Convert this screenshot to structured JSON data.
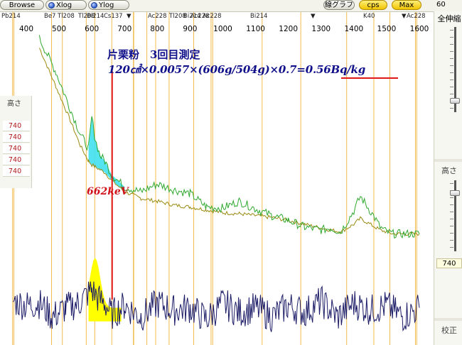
{
  "toolbar": {
    "browse_label": "Browse",
    "xlog_label": "Xlog",
    "ylog_label": "Ylog",
    "linegraph_label": "線グラフ",
    "cps_label": "cps",
    "max_label": "Max",
    "right_value": "60"
  },
  "axis": {
    "ticks": [
      "400",
      "500",
      "600",
      "700",
      "800",
      "900",
      "1000",
      "1100",
      "1200",
      "1300",
      "1400",
      "1500",
      "1600"
    ],
    "nuclides": [
      {
        "label": "Pb214"
      },
      {
        "label": "Be7"
      },
      {
        "label": "Tl208"
      },
      {
        "label": "Tl208"
      },
      {
        "label": "Bi214"
      },
      {
        "label": "Cs137"
      },
      {
        "label": "▼"
      },
      {
        "label": "Ac228"
      },
      {
        "label": "Tl208"
      },
      {
        "label": "Bi214"
      },
      {
        "label": "Ac228"
      },
      {
        "label": "Ac228"
      },
      {
        "label": "Bi214"
      },
      {
        "label": "▼"
      },
      {
        "label": "K40"
      },
      {
        "label": "▼"
      },
      {
        "label": "Ac228"
      }
    ]
  },
  "mini_panel": {
    "header": "高さ",
    "rows": [
      "740",
      "740",
      "740",
      "740",
      "740"
    ]
  },
  "side_panel": {
    "top_title": "全伸縮",
    "mid_title": "高さ",
    "mid_value": "740",
    "bottom_title": "校正"
  },
  "annotation": {
    "title": "片栗粉　3回目測定",
    "formula_prefix": "120㎠×0.0057×(606g/504g)×0.7=",
    "result": "0.56Bq/kg",
    "energy": "662keV"
  },
  "colors": {
    "sample_line": "#2ea82e",
    "background_line": "#9a8a10",
    "difference_line": "#1a1a66",
    "nuclide_marker": "#f0b030",
    "cs137_marker": "#e01818",
    "peak_fill_upper": "#40e0f0",
    "peak_fill_lower": "#ffff00"
  },
  "chart_data": {
    "type": "line",
    "xlabel": "",
    "ylabel": "",
    "xlim": [
      355,
      1620
    ],
    "series": [
      {
        "x": [
          440,
          490,
          530,
          565,
          590,
          600,
          610,
          625,
          640,
          660,
          700,
          750,
          800,
          850,
          900,
          950,
          1000,
          1050,
          1100,
          1150,
          1200,
          1250,
          1300,
          1330,
          1360,
          1400,
          1420,
          1440,
          1460,
          1480,
          1500,
          1520,
          1560,
          1600
        ],
        "values": [
          240,
          205,
          170,
          140,
          125,
          158,
          135,
          118,
          112,
          98,
          85,
          80,
          88,
          82,
          78,
          64,
          63,
          70,
          62,
          55,
          50,
          43,
          40,
          42,
          38,
          60,
          75,
          65,
          55,
          43,
          38,
          36,
          36,
          36
        ]
      },
      {
        "x": [
          440,
          490,
          530,
          565,
          590,
          600,
          610,
          625,
          640,
          660,
          700,
          750,
          800,
          850,
          900,
          950,
          1000,
          1050,
          1100,
          1150,
          1200,
          1250,
          1300,
          1330,
          1360,
          1400,
          1420,
          1440,
          1460,
          1480,
          1500,
          1520,
          1560,
          1600
        ],
        "values": [
          230,
          190,
          158,
          128,
          112,
          108,
          106,
          103,
          100,
          92,
          80,
          73,
          70,
          66,
          64,
          61,
          58,
          57,
          55,
          53,
          50,
          46,
          42,
          40,
          38,
          46,
          52,
          48,
          44,
          40,
          38,
          36,
          36,
          36
        ]
      },
      {
        "x": [
          360,
          400,
          440,
          480,
          520,
          560,
          600,
          620,
          640,
          660,
          700,
          750,
          800,
          850,
          900,
          950,
          1000,
          1050,
          1100,
          1150,
          1200,
          1250,
          1300,
          1350,
          1400,
          1450,
          1500,
          1550,
          1600
        ],
        "values": [
          5,
          3,
          4,
          -2,
          2,
          4,
          10,
          6,
          4,
          -1,
          3,
          -2,
          4,
          1,
          2,
          -3,
          4,
          0,
          2,
          -2,
          3,
          0,
          5,
          -2,
          4,
          1,
          3,
          -2,
          2
        ]
      }
    ]
  }
}
